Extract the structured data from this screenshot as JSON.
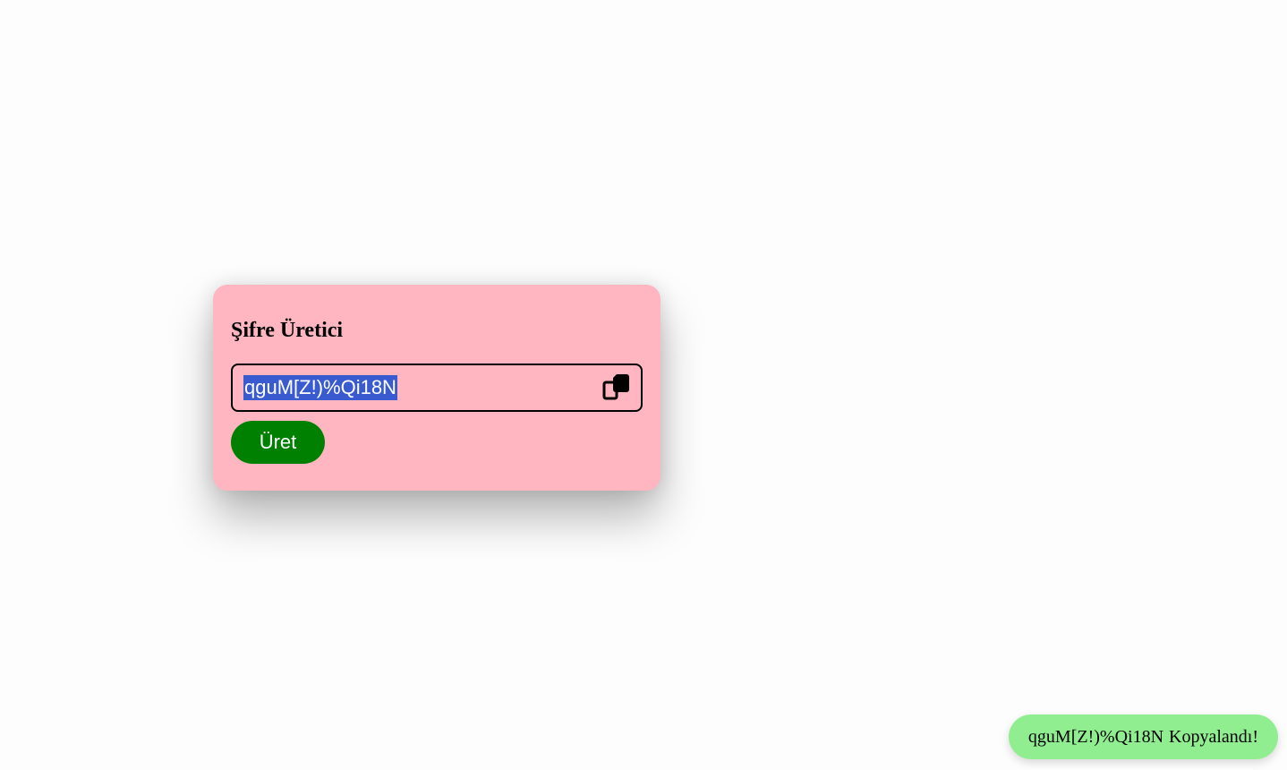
{
  "card": {
    "title": "Şifre Üretici",
    "password_value": "qguM[Z!)%Qi18N",
    "copy_icon": "copy-icon",
    "generate_label": "Üret"
  },
  "toast": {
    "password": "qguM[Z!)%Qi18N",
    "message": "Kopyalandı!"
  },
  "colors": {
    "card_background": "#ffb6c1",
    "generate_button": "#008000",
    "toast_background": "#90ee90",
    "selection_highlight": "#3a5bd0"
  }
}
